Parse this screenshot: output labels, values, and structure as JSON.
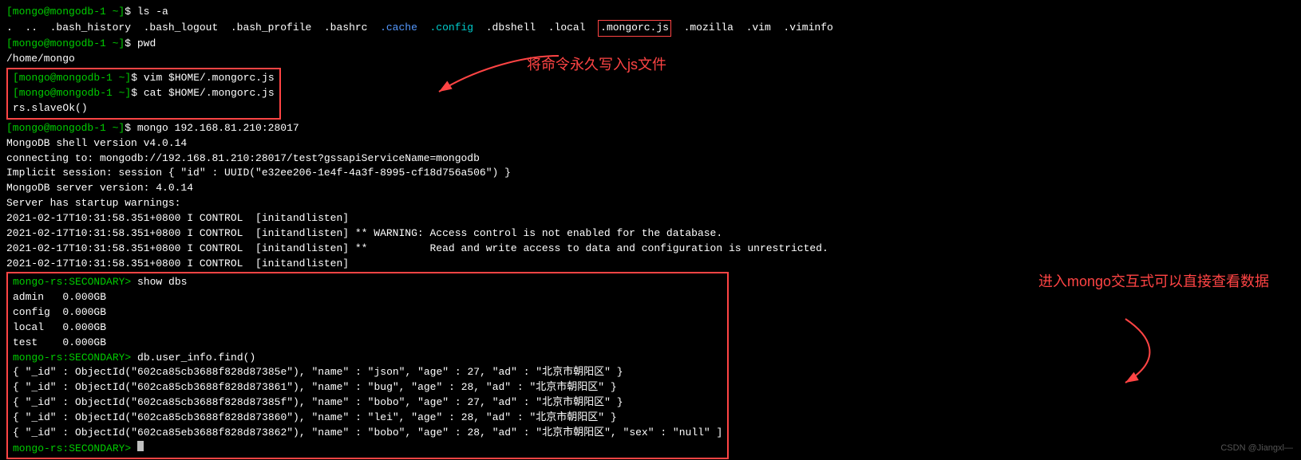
{
  "terminal": {
    "lines": [
      {
        "id": "line1",
        "parts": [
          {
            "text": "[mongo@mongodb-1 ~]",
            "color": "green"
          },
          {
            "text": "$ ls -a",
            "color": "white"
          }
        ]
      },
      {
        "id": "line2",
        "parts": [
          {
            "text": ".  ..  .bash_history  .bash_logout  .bash_profile  .bashrc  ",
            "color": "white"
          },
          {
            "text": ".cache",
            "color": "cache-blue"
          },
          {
            "text": "  ",
            "color": "white"
          },
          {
            "text": ".config",
            "color": "config-cyan"
          },
          {
            "text": "  .dbshell  .local  ",
            "color": "white"
          },
          {
            "text": ".mongorc.js",
            "color": "mongorc-highlight"
          },
          {
            "text": "  ",
            "color": "white"
          },
          {
            "text": ".mozilla",
            "color": "white"
          },
          {
            "text": "  .vim  .viminfo",
            "color": "white"
          }
        ]
      },
      {
        "id": "line3",
        "parts": [
          {
            "text": "[mongo@mongodb-1 ~]",
            "color": "green"
          },
          {
            "text": "$ pwd",
            "color": "white"
          }
        ]
      },
      {
        "id": "line4",
        "parts": [
          {
            "text": "/home/mongo",
            "color": "white"
          }
        ]
      }
    ],
    "prompt_box_lines": [
      {
        "id": "pb1",
        "prompt": "[mongo@mongodb-1 ~]",
        "cmd": "$ vim $HOME/.mongorc.js"
      },
      {
        "id": "pb2",
        "prompt": "[mongo@mongodb-1 ~]",
        "cmd": "$ cat $HOME/.mongorc.js"
      },
      {
        "id": "pb3",
        "text": "rs.slaveOk()"
      }
    ],
    "mongo_connect": {
      "prompt": "[mongo@mongodb-1 ~]",
      "cmd": "$ mongo 192.168.81.210:28017",
      "version_line": "MongoDB shell version v4.0.14",
      "connecting_line": "connecting to: mongodb://192.168.81.210:28017/test?gssapiServiceName=mongodb",
      "implicit_line": "Implicit session: session { \"id\" : UUID(\"e32ee206-1e4f-4a3f-8995-cf18d756a506\") }",
      "server_version": "MongoDB server version: 4.0.14",
      "startup_warn": "Server has startup warnings:",
      "warn_lines": [
        "2021-02-17T10:31:58.351+0800 I CONTROL  [initandlisten]",
        "2021-02-17T10:31:58.351+0800 I CONTROL  [initandlisten] ** WARNING: Access control is not enabled for the database.",
        "2021-02-17T10:31:58.351+0800 I CONTROL  [initandlisten] **          Read and write access to data and configuration is unrestricted.",
        "2021-02-17T10:31:58.351+0800 I CONTROL  [initandlisten]"
      ]
    },
    "mongo_interactive": {
      "show_dbs_prompt": "mongo-rs:SECONDARY> show dbs",
      "dbs": [
        {
          "name": "admin",
          "size": "0.000GB"
        },
        {
          "name": "config",
          "size": "0.000GB"
        },
        {
          "name": "local",
          "size": "0.000GB"
        },
        {
          "name": "test",
          "size": "0.000GB"
        }
      ],
      "find_prompt": "mongo-rs:SECONDARY> db.user_info.find()",
      "find_results": [
        "{ \"_id\" : ObjectId(\"602ca85cb3688f828d87385e\"), \"name\" : \"json\", \"age\" : 27, \"ad\" : \"北京市朝阳区\" }",
        "{ \"_id\" : ObjectId(\"602ca85cb3688f828d873861\"), \"name\" : \"bug\", \"age\" : 28, \"ad\" : \"北京市朝阳区\" }",
        "{ \"_id\" : ObjectId(\"602ca85cb3688f828d87385f\"), \"name\" : \"bobo\", \"age\" : 27, \"ad\" : \"北京市朝阳区\" }",
        "{ \"_id\" : ObjectId(\"602ca85cb3688f828d873860\"), \"name\" : \"lei\", \"age\" : 28, \"ad\" : \"北京市朝阳区\" }",
        "{ \"_id\" : ObjectId(\"602ca85eb3688f828d873862\"), \"name\" : \"bobo\", \"age\" : 28, \"ad\" : \"北京市朝阳区\", \"sex\" : \"null\" ]"
      ],
      "final_prompt": "mongo-rs:SECONDARY>"
    }
  },
  "annotations": {
    "top_right": "将命令永久写入js文件",
    "bottom_right": "进入mongo交互式可以直接查看数据"
  },
  "watermark": "CSDN @Jiangxl—"
}
